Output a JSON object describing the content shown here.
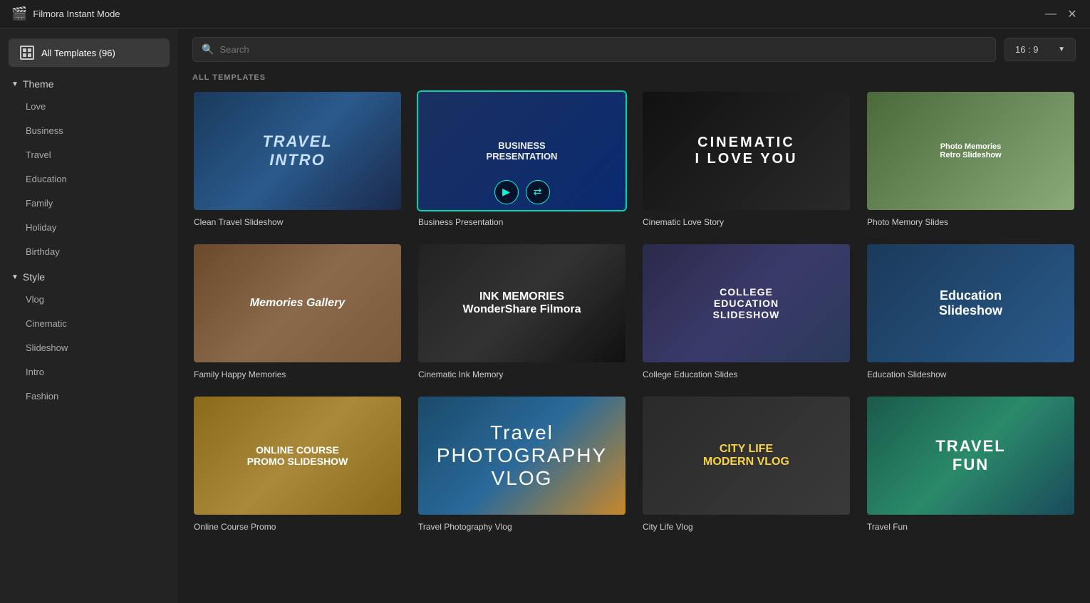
{
  "titleBar": {
    "title": "Filmora Instant Mode",
    "minimize": "—",
    "close": "✕"
  },
  "sidebar": {
    "allTemplates": "All Templates (96)",
    "sections": [
      {
        "label": "Theme",
        "items": [
          "Love",
          "Business",
          "Travel",
          "Education",
          "Family",
          "Holiday",
          "Birthday"
        ]
      },
      {
        "label": "Style",
        "items": [
          "Vlog",
          "Cinematic",
          "Slideshow",
          "Intro",
          "Fashion"
        ]
      }
    ]
  },
  "topBar": {
    "searchPlaceholder": "Search",
    "aspectRatio": "16 : 9"
  },
  "sectionLabel": "ALL TEMPLATES",
  "templates": [
    {
      "id": "clean-travel",
      "title": "Clean Travel Slideshow",
      "thumbClass": "thumb-travel-intro",
      "thumbText": "TRAVEL\nINTRO",
      "selected": false
    },
    {
      "id": "business-presentation",
      "title": "Business Presentation",
      "thumbClass": "thumb-business",
      "thumbText": "BUSINESS\nPRESENTATION",
      "selected": true
    },
    {
      "id": "cinematic-love",
      "title": "Cinematic Love Story",
      "thumbClass": "thumb-cinematic",
      "thumbText": "CINEMATIC\nI LOVE YOU",
      "selected": false
    },
    {
      "id": "photo-memory",
      "title": "Photo Memory Slides",
      "thumbClass": "thumb-photo-memory",
      "thumbText": "Photo Memories\nRetro Slideshow",
      "selected": false
    },
    {
      "id": "family-happy",
      "title": "Family Happy Memories",
      "thumbClass": "thumb-family",
      "thumbText": "Memories Gallery",
      "selected": false
    },
    {
      "id": "cinematic-ink",
      "title": "Cinematic Ink Memory",
      "thumbClass": "thumb-ink",
      "thumbText": "INK MEMORIES\nWonderShare Filmora",
      "selected": false
    },
    {
      "id": "college-education",
      "title": "College Education Slides",
      "thumbClass": "thumb-college",
      "thumbText": "COLLEGE\nEDUCATION\nSLIDESHOW",
      "selected": false
    },
    {
      "id": "education-slideshow",
      "title": "Education Slideshow",
      "thumbClass": "thumb-education",
      "thumbText": "Education\nSlideshow",
      "selected": false
    },
    {
      "id": "online-course",
      "title": "Online Course Promo",
      "thumbClass": "thumb-online-course",
      "thumbText": "ONLINE COURSE\nPROMO SLIDESHOW",
      "selected": false
    },
    {
      "id": "travel-photo",
      "title": "Travel Photography Vlog",
      "thumbClass": "thumb-travel-photo",
      "thumbText": "Travel\nPHOTOGRAPHY VLOG",
      "selected": false
    },
    {
      "id": "city-life",
      "title": "City Life Vlog",
      "thumbClass": "thumb-city-life",
      "thumbText": "CITY LIFE\nMODERN VLOG",
      "selected": false
    },
    {
      "id": "travel-fun",
      "title": "Travel Fun",
      "thumbClass": "thumb-travel-fun",
      "thumbText": "TRAVEL\nFUN",
      "selected": false
    }
  ]
}
